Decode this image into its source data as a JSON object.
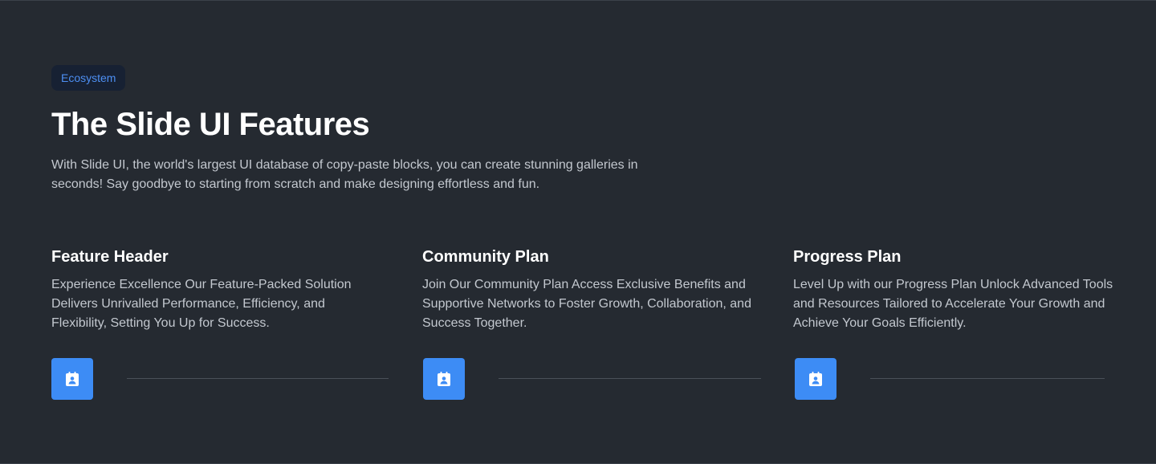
{
  "badge": {
    "label": "Ecosystem"
  },
  "header": {
    "title": "The Slide UI Features",
    "subtitle": "With Slide UI, the world's largest UI database of copy-paste blocks, you can create stunning galleries in seconds! Say goodbye to starting from scratch and make designing effortless and fun."
  },
  "features": [
    {
      "title": "Feature Header",
      "text": "Experience Excellence Our Feature-Packed Solution Delivers Unrivalled Performance, Efficiency, and Flexibility, Setting You Up for Success.",
      "icon": "calendar-user-icon"
    },
    {
      "title": "Community Plan",
      "text": "Join Our Community Plan Access Exclusive Benefits and Supportive Networks to Foster Growth, Collaboration, and Success Together.",
      "icon": "calendar-user-icon"
    },
    {
      "title": "Progress Plan",
      "text": "Level Up with our Progress Plan Unlock Advanced Tools and Resources Tailored to Accelerate Your Growth and Achieve Your Goals Efficiently.",
      "icon": "calendar-user-icon"
    }
  ],
  "colors": {
    "background": "#252a31",
    "accent": "#3d8cf5",
    "badge_text": "#4d8ff3",
    "badge_bg": "#172133",
    "body_text": "#c3c8cf"
  }
}
